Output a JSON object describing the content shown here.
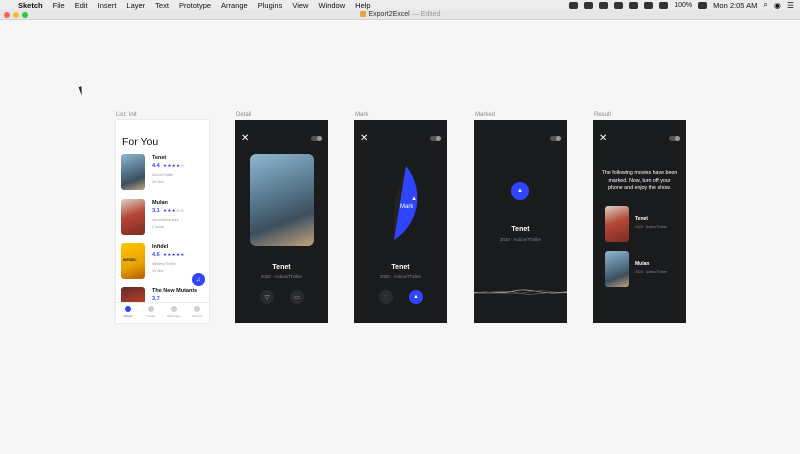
{
  "menubar": {
    "items": [
      "Sketch",
      "File",
      "Edit",
      "Insert",
      "Layer",
      "Text",
      "Prototype",
      "Arrange",
      "Plugins",
      "View",
      "Window",
      "Help"
    ],
    "battery": "100%",
    "clock": "Mon 2:05 AM"
  },
  "window": {
    "title": "Export2Excel",
    "status": "— Edited"
  },
  "artboards": {
    "list": {
      "label": "List: Init",
      "heading": "For You",
      "movies": [
        {
          "name": "Tenet",
          "rating": "4.4",
          "stars": "★★★★☆",
          "genre": "Action/Thriller",
          "duration": "2h 30m"
        },
        {
          "name": "Mulan",
          "rating": "3.1",
          "stars": "★★★☆☆",
          "genre": "Action/Adventure",
          "duration": "2 hours"
        },
        {
          "name": "Infidel",
          "rating": "4.6",
          "stars": "★★★★★",
          "genre": "Mystery/Thriller",
          "duration": "1h 48m"
        },
        {
          "name": "The New Mutants",
          "rating": "3.7",
          "stars": "★★★★☆",
          "genre": "",
          "duration": ""
        }
      ],
      "tabs": [
        "Movies",
        "Theater",
        "Discussion",
        "Account"
      ],
      "poster_title": "INFIDEL"
    },
    "detail": {
      "label": "Detail",
      "title": "Tenet",
      "meta": "2020 · Action/Thriller"
    },
    "mark": {
      "label": "Mark",
      "mark_text": "Mark",
      "title": "Tenet",
      "meta": "2020 · Action/Thriller"
    },
    "marked": {
      "label": "Marked",
      "title": "Tenet",
      "meta": "2020 · Action/Thriller"
    },
    "result": {
      "label": "Result",
      "message": "The following movies have been marked. Now, turn off your phone and enjoy the show.",
      "movies": [
        {
          "name": "Tenet",
          "genre": "2020 · Action/Thriller"
        },
        {
          "name": "Mulan",
          "genre": "2020 · Action/Thriller"
        }
      ]
    }
  },
  "colors": {
    "accent": "#2f45ff",
    "dark_board": "#1a1b1d",
    "canvas": "#f6f6f6"
  }
}
